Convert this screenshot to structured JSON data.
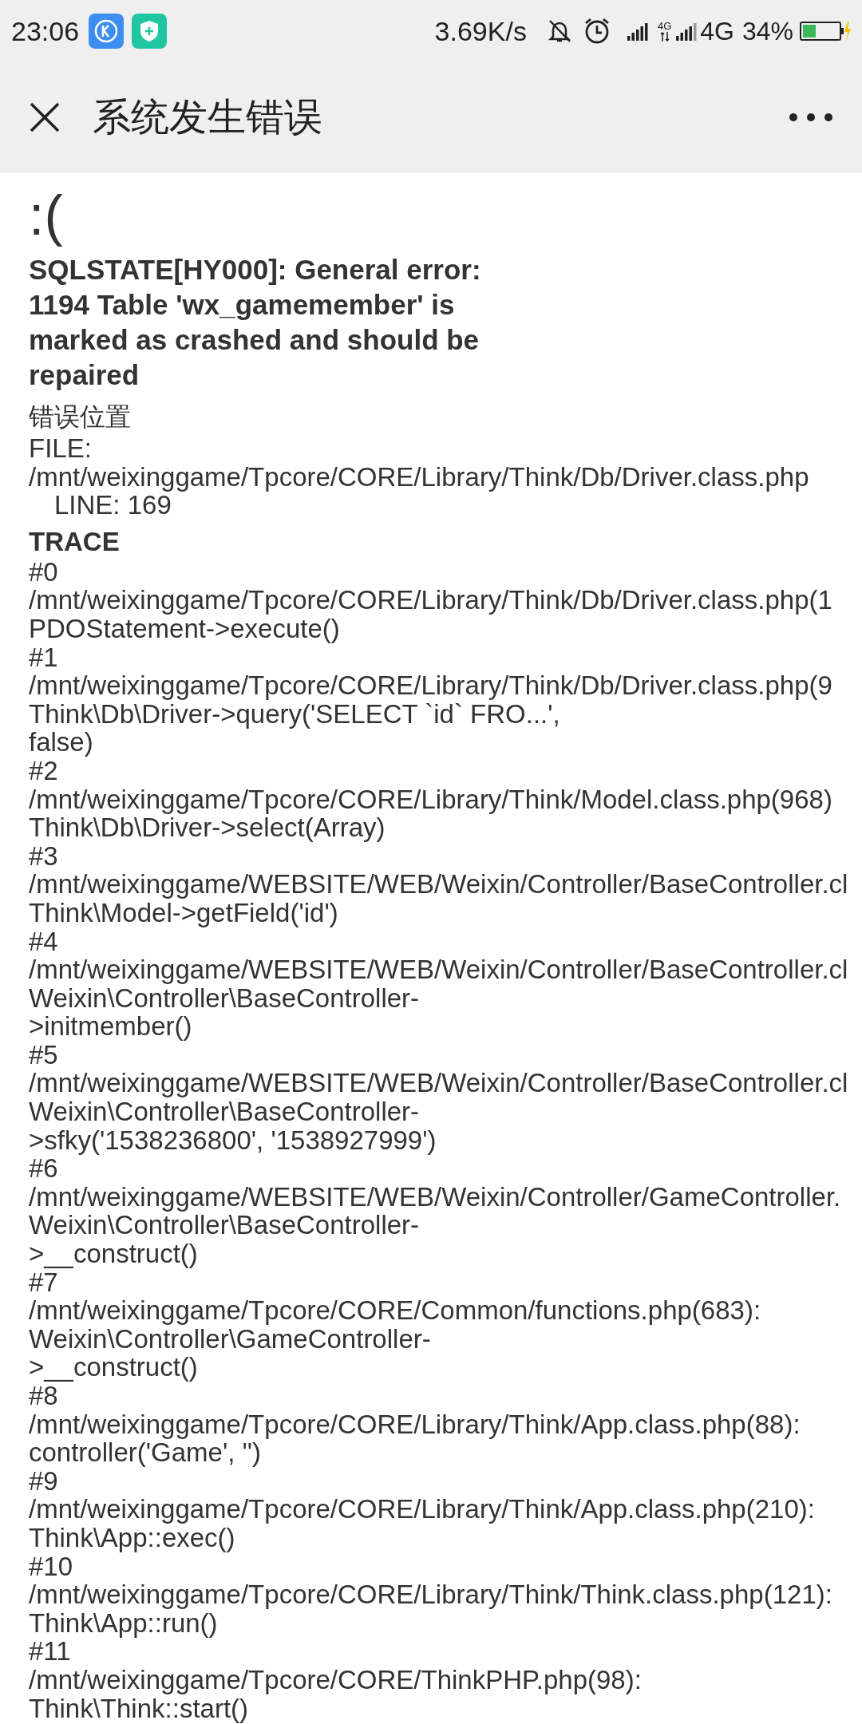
{
  "status_bar": {
    "time": "23:06",
    "network_speed": "3.69K/s",
    "data_small": "4G",
    "data_type": "4G",
    "battery": "34%"
  },
  "header": {
    "title": "系统发生错误"
  },
  "error": {
    "face": ":(",
    "message": "SQLSTATE[HY000]: General error: 1194 Table 'wx_gamemember' is marked as crashed and should be repaired",
    "location_heading": "错误位置",
    "file_label": "FILE:",
    "file_path": "/mnt/weixinggame/Tpcore/CORE/Library/Think/Db/Driver.class.php",
    "line": "LINE: 169",
    "trace_heading": "TRACE",
    "trace": [
      {
        "index": "#0",
        "lines": [
          "/mnt/weixinggame/Tpcore/CORE/Library/Think/Db/Driver.class.php(1",
          "PDOStatement->execute()"
        ]
      },
      {
        "index": "#1",
        "lines": [
          "/mnt/weixinggame/Tpcore/CORE/Library/Think/Db/Driver.class.php(9",
          "Think\\Db\\Driver->query('SELECT `id` FRO...',",
          "false)"
        ]
      },
      {
        "index": "#2",
        "lines": [
          "/mnt/weixinggame/Tpcore/CORE/Library/Think/Model.class.php(968)",
          "Think\\Db\\Driver->select(Array)"
        ]
      },
      {
        "index": "#3",
        "lines": [
          "/mnt/weixinggame/WEBSITE/WEB/Weixin/Controller/BaseController.cl",
          "Think\\Model->getField('id')"
        ]
      },
      {
        "index": "#4",
        "lines": [
          "/mnt/weixinggame/WEBSITE/WEB/Weixin/Controller/BaseController.cl",
          "Weixin\\Controller\\BaseController-",
          ">initmember()"
        ]
      },
      {
        "index": "#5",
        "lines": [
          "/mnt/weixinggame/WEBSITE/WEB/Weixin/Controller/BaseController.cl",
          "Weixin\\Controller\\BaseController-",
          ">sfky('1538236800', '1538927999')"
        ]
      },
      {
        "index": "#6",
        "lines": [
          "/mnt/weixinggame/WEBSITE/WEB/Weixin/Controller/GameController.",
          "Weixin\\Controller\\BaseController-",
          ">__construct()"
        ]
      },
      {
        "index": "#7",
        "lines": [
          "/mnt/weixinggame/Tpcore/CORE/Common/functions.php(683):",
          "Weixin\\Controller\\GameController-",
          ">__construct()"
        ]
      },
      {
        "index": "#8",
        "lines": [
          "/mnt/weixinggame/Tpcore/CORE/Library/Think/App.class.php(88):",
          "controller('Game', '')"
        ]
      },
      {
        "index": "#9",
        "lines": [
          "/mnt/weixinggame/Tpcore/CORE/Library/Think/App.class.php(210):",
          "Think\\App::exec()"
        ]
      },
      {
        "index": "#10",
        "lines": [
          "/mnt/weixinggame/Tpcore/CORE/Library/Think/Think.class.php(121):",
          "Think\\App::run()"
        ]
      },
      {
        "index": "#11",
        "lines": [
          "/mnt/weixinggame/Tpcore/CORE/ThinkPHP.php(98):",
          "Think\\Think::start()"
        ]
      }
    ]
  }
}
